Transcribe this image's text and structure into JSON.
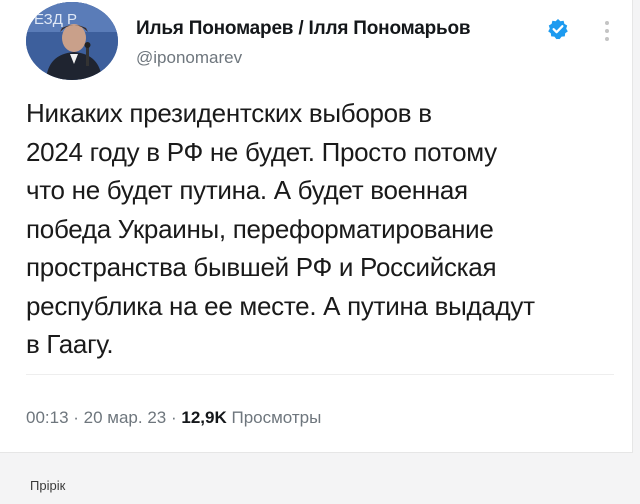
{
  "tweet": {
    "display_name": "Илья Пономарев / Ілля Пономарьов",
    "handle": "@iponomarev",
    "text": "Никаких президентских выборов в\n2024 году в РФ не будет. Просто потому\nчто не будет путина. А будет военная\nпобеда Украины, переформатирование\nпространства бывшей РФ и Российская\nреспублика на ее месте. А путина выдадут\nв Гаагу.",
    "time": "00:13",
    "date": "20 мар. 23",
    "views_count": "12,9K",
    "views_label": "Просмотры",
    "separator": " · "
  },
  "avatar_banner_text": "ЕЗД Р",
  "footer": {
    "label": "Прірік"
  },
  "colors": {
    "verified": "#1d9bf0",
    "text": "#1a1a1a",
    "muted": "#6e767d"
  },
  "icons": {
    "verified": "verified-badge-icon",
    "more": "more-options-icon"
  }
}
